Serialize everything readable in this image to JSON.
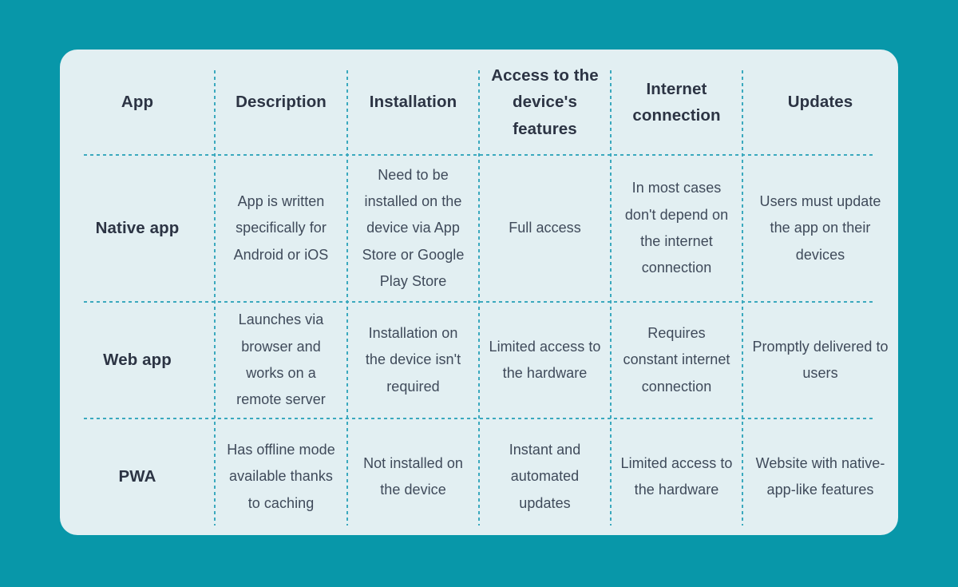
{
  "theme": {
    "page_background": "#0897a9",
    "card_background": "#e2eff2",
    "rule_color": "#3ba9be",
    "heading_text_color": "#2c3444",
    "body_text_color": "#3f4a5a"
  },
  "table": {
    "columns": [
      "App",
      "Description",
      "Installation",
      "Access to the device's features",
      "Internet connection",
      "Updates"
    ],
    "rows": [
      {
        "app": "Native app",
        "description": "App is written specifically for Android or iOS",
        "installation": "Need to be installed on the device via App Store or Google Play Store",
        "device_features": "Full access",
        "internet_connection": "In most cases don't depend on the internet connection",
        "updates": "Users must update the app on their devices"
      },
      {
        "app": "Web app",
        "description": "Launches via browser and works on a remote server",
        "installation": "Installation on the device isn't required",
        "device_features": "Limited access to the hardware",
        "internet_connection": "Requires constant internet connection",
        "updates": "Promptly delivered to users"
      },
      {
        "app": "PWA",
        "description": "Has offline mode available thanks to caching",
        "installation": "Not installed on the device",
        "device_features": "Instant and automated updates",
        "internet_connection": "Limited access to the hardware",
        "updates": "Website with native-app-like features"
      }
    ]
  }
}
